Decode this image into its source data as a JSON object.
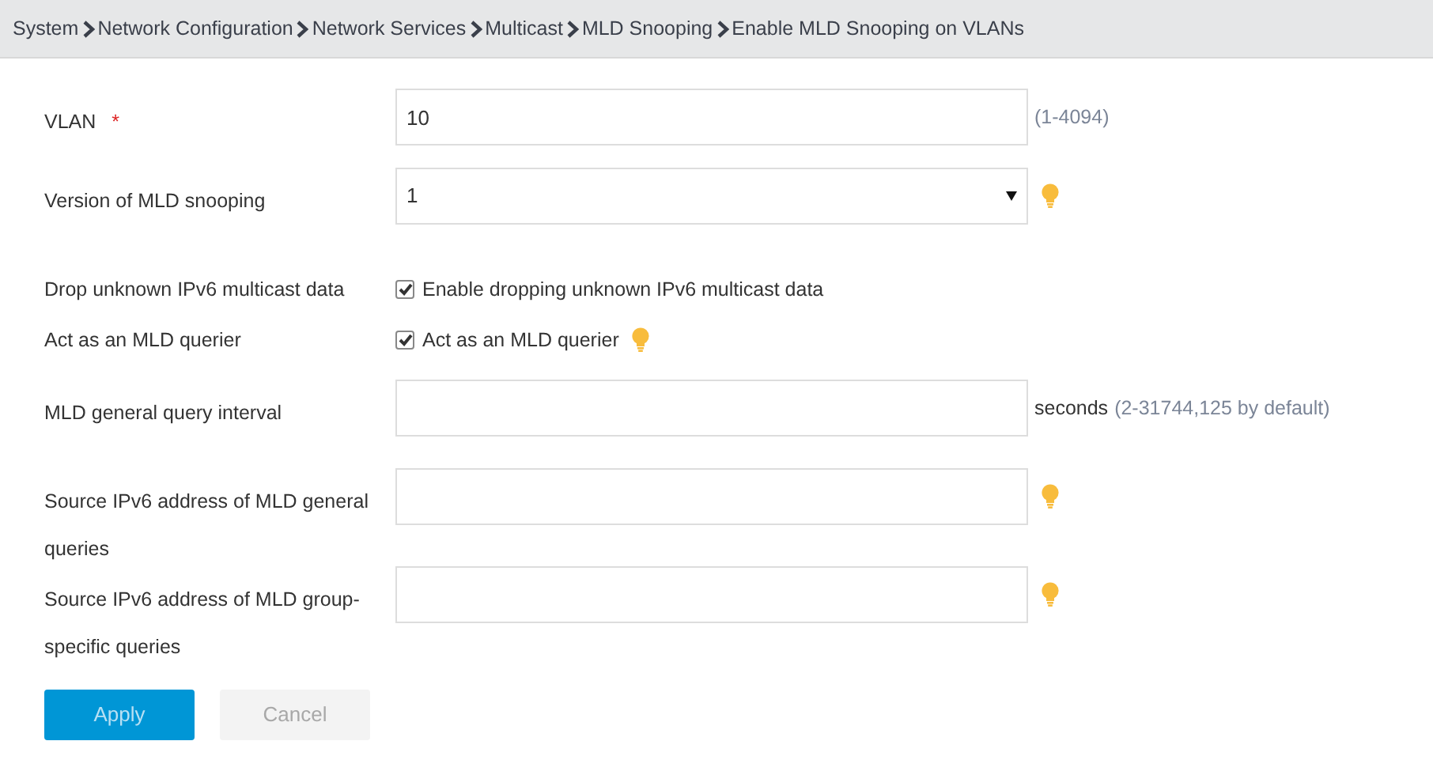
{
  "breadcrumb": [
    "System",
    "Network Configuration",
    "Network Services",
    "Multicast",
    "MLD Snooping",
    "Enable MLD Snooping on VLANs"
  ],
  "fields": [
    {
      "kind": "text",
      "label": "VLAN",
      "required_mark": "*",
      "value": "10",
      "range": "(1-4094)",
      "tip": false
    },
    {
      "kind": "select",
      "label": "Version of MLD snooping",
      "value": "1",
      "tip": true
    },
    {
      "kind": "checkbox",
      "label": "Drop unknown IPv6 multicast data",
      "option": "Enable dropping unknown IPv6 multicast data",
      "checked": true,
      "tip": false
    },
    {
      "kind": "checkbox",
      "label": "Act as an MLD querier",
      "option": "Act as an MLD querier",
      "checked": true,
      "tip": true
    },
    {
      "kind": "text",
      "label": "MLD general query interval",
      "unit": "seconds",
      "range": "(2-31744,125 by default)",
      "tip": false
    },
    {
      "kind": "text",
      "label": "Source IPv6 address of MLD general queries",
      "tip": true
    },
    {
      "kind": "text",
      "label": "Source IPv6 address of MLD group-specific queries",
      "tip": true
    }
  ],
  "buttons": [
    {
      "label": "Apply",
      "kind": "primary",
      "disabled": true
    },
    {
      "label": "Cancel",
      "kind": "secondary",
      "disabled": true
    }
  ]
}
